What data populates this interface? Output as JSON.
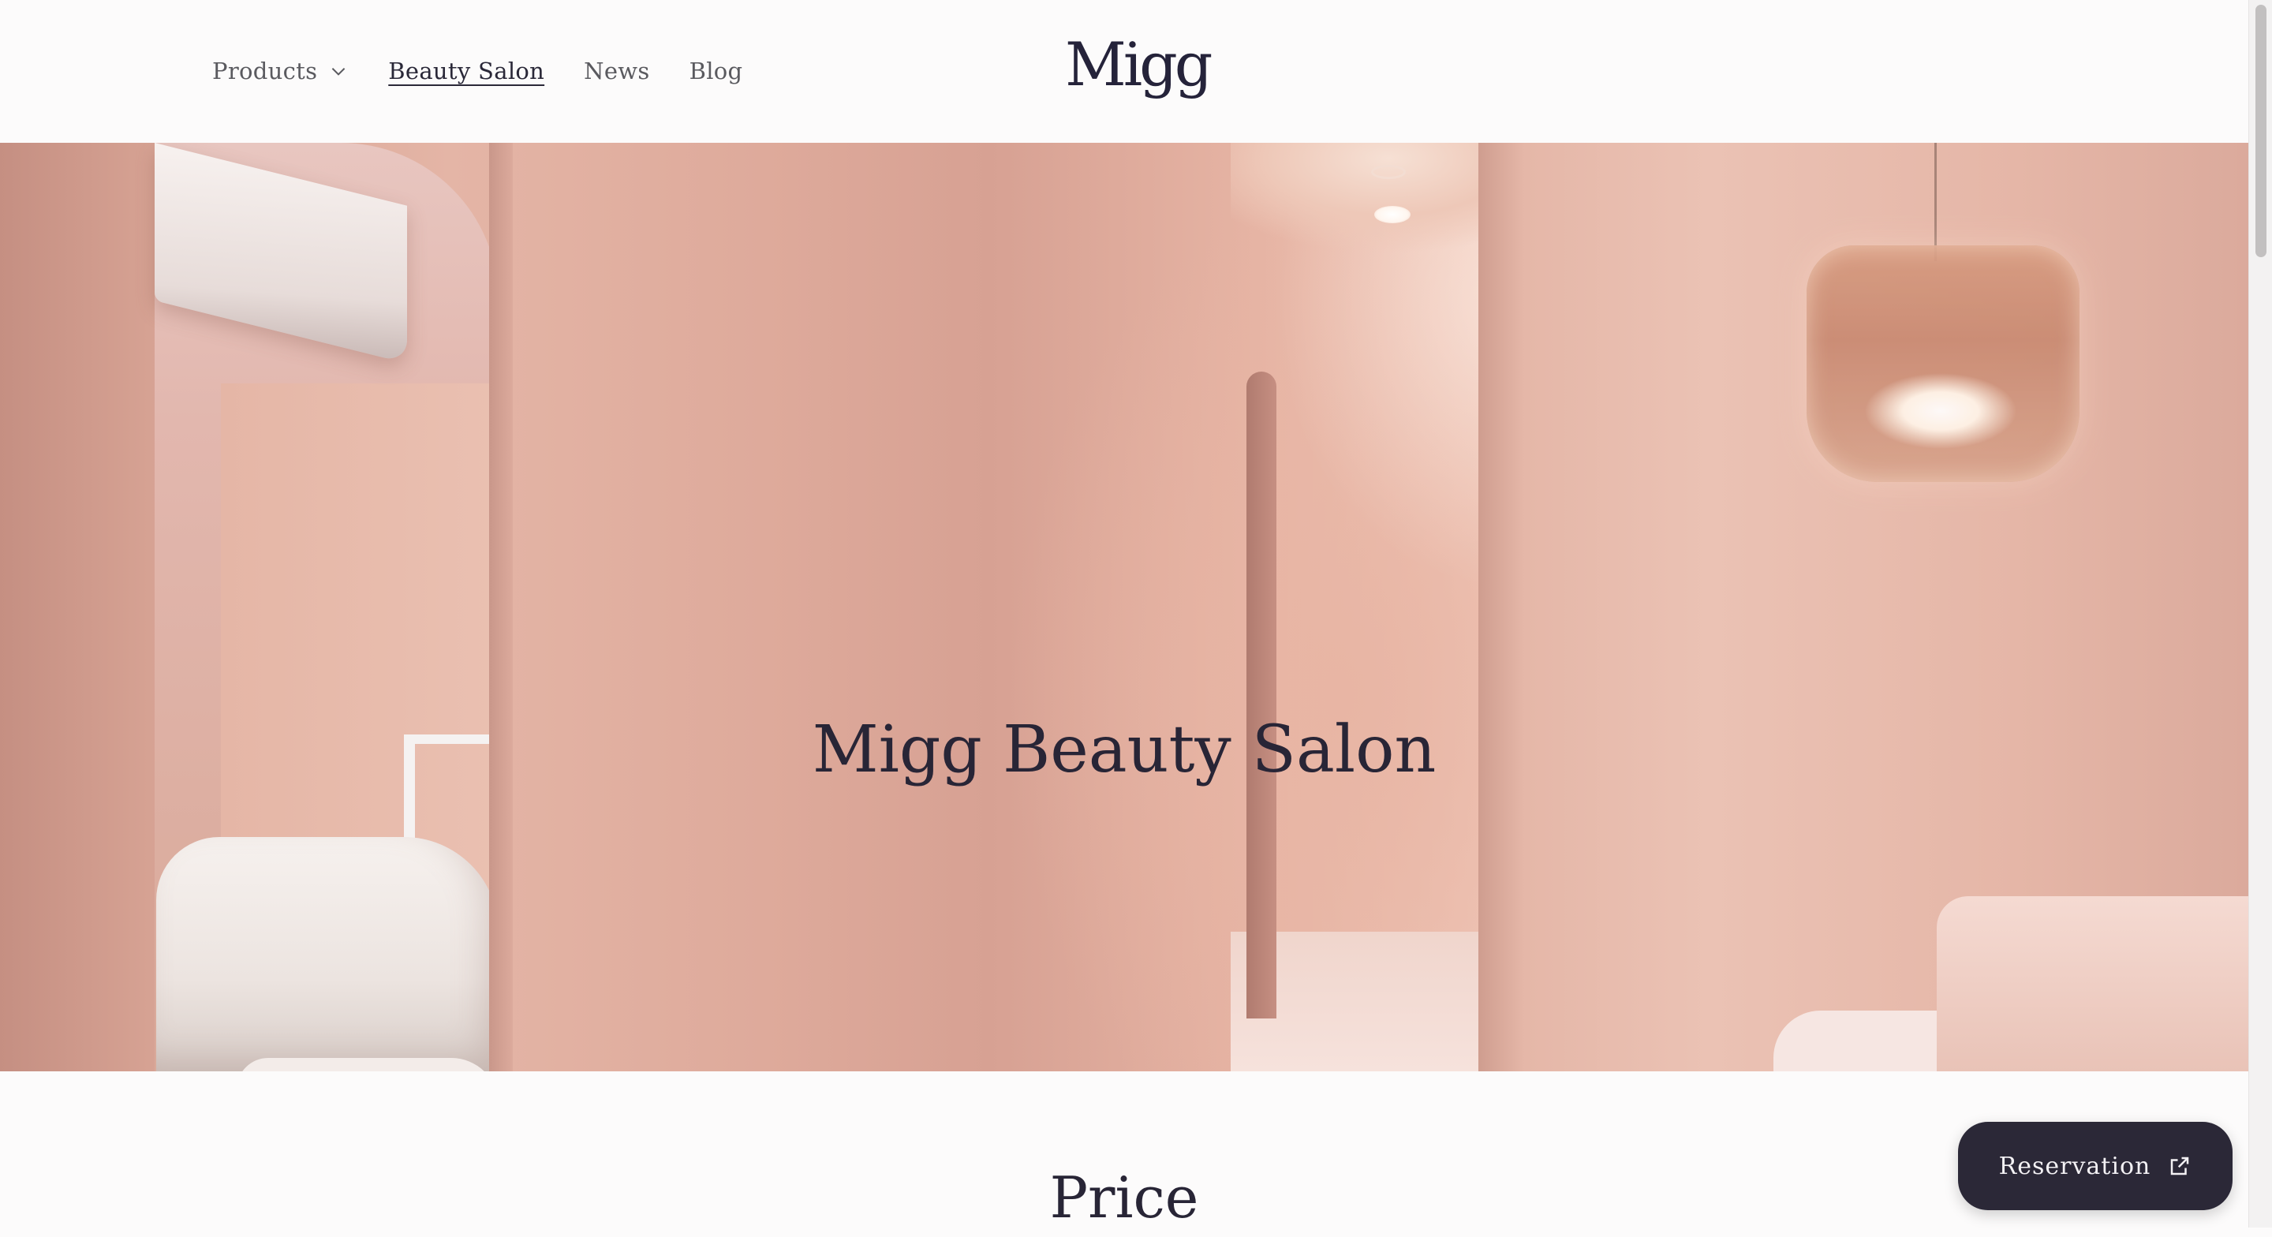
{
  "nav": {
    "items": [
      {
        "label": "Products",
        "has_dropdown": true,
        "active": false
      },
      {
        "label": "Beauty Salon",
        "has_dropdown": false,
        "active": true
      },
      {
        "label": "News",
        "has_dropdown": false,
        "active": false
      },
      {
        "label": "Blog",
        "has_dropdown": false,
        "active": false
      }
    ]
  },
  "brand": {
    "logo_text": "Migg"
  },
  "hero": {
    "title": "Migg Beauty Salon"
  },
  "price": {
    "title": "Price"
  },
  "reservation": {
    "label": "Reservation",
    "icon": "external-link-icon"
  },
  "colors": {
    "text_dark": "#282536",
    "nav_text": "#5a5a5f",
    "button_bg": "#2b2837",
    "hero_tone": "#e4b5a6",
    "page_bg": "#fcfbfb"
  }
}
